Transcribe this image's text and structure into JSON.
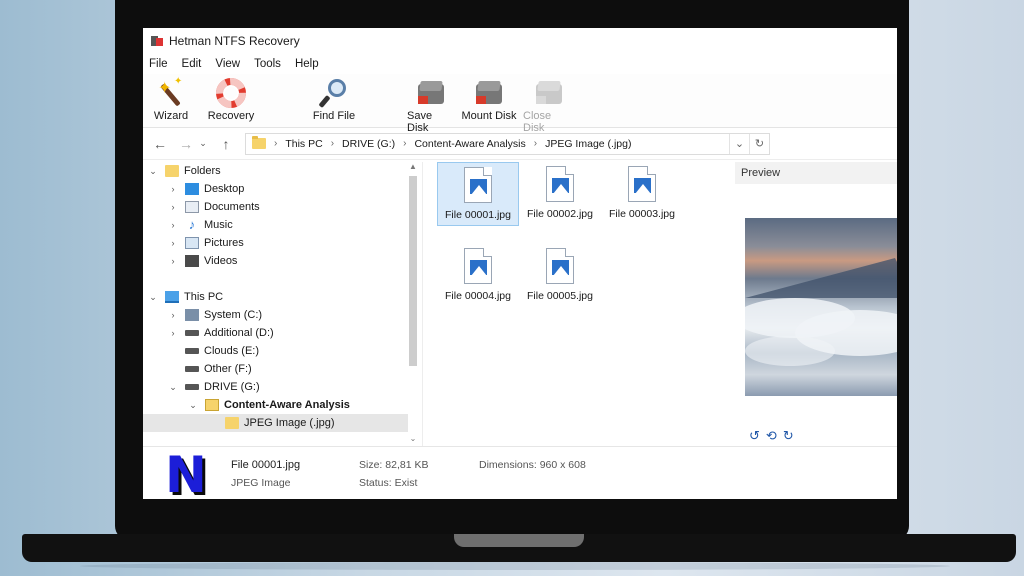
{
  "window": {
    "title": "Hetman NTFS Recovery"
  },
  "menu": [
    "File",
    "Edit",
    "View",
    "Tools",
    "Help"
  ],
  "toolbar": {
    "wizard": "Wizard",
    "recovery": "Recovery",
    "find_file": "Find File",
    "save_disk": "Save Disk",
    "mount_disk": "Mount Disk",
    "close_disk": "Close Disk"
  },
  "address": {
    "parts": [
      "This PC",
      "DRIVE (G:)",
      "Content-Aware Analysis",
      "JPEG Image (.jpg)"
    ],
    "dropdown_icon": "chevron-down-icon",
    "refresh_icon": "refresh-icon"
  },
  "tree": {
    "folders": "Folders",
    "desktop": "Desktop",
    "documents": "Documents",
    "music": "Music",
    "pictures": "Pictures",
    "videos": "Videos",
    "this_pc": "This PC",
    "system": "System (C:)",
    "additional": "Additional (D:)",
    "clouds": "Clouds (E:)",
    "other": "Other (F:)",
    "drive_g": "DRIVE (G:)",
    "caa": "Content-Aware Analysis",
    "jpeg": "JPEG Image (.jpg)"
  },
  "files": [
    {
      "name": "File 00001.jpg",
      "selected": true
    },
    {
      "name": "File 00002.jpg",
      "selected": false
    },
    {
      "name": "File 00003.jpg",
      "selected": false
    },
    {
      "name": "File 00004.jpg",
      "selected": false
    },
    {
      "name": "File 00005.jpg",
      "selected": false
    }
  ],
  "preview": {
    "title": "Preview"
  },
  "details": {
    "name": "File 00001.jpg",
    "type": "JPEG Image",
    "size": "Size: 82,81 KB",
    "status": "Status: Exist",
    "dimensions": "Dimensions: 960 x 608",
    "logo_letter": "N"
  },
  "colors": {
    "selection": "#d9eafa",
    "accent_blue": "#2057a8",
    "logo": "#1c1ed8"
  }
}
